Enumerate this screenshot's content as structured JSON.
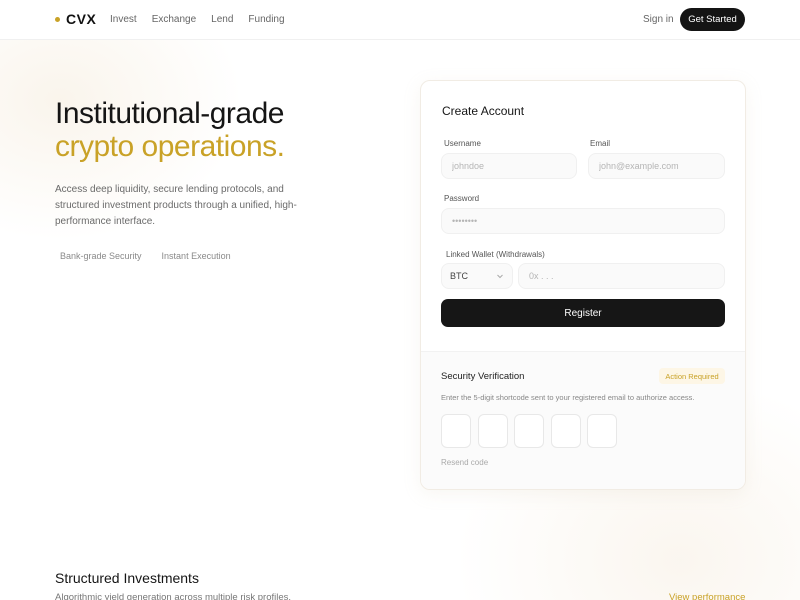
{
  "brand": {
    "name": "CVX",
    "accent": "#c9a227"
  },
  "nav": {
    "links": [
      "Invest",
      "Exchange",
      "Lend",
      "Funding"
    ],
    "sign_in": "Sign in",
    "cta": "Get Started"
  },
  "hero": {
    "title_line1": "Institutional-grade",
    "title_line2": "crypto operations.",
    "description": "Access deep liquidity, secure lending protocols, and structured investment products through a unified, high-performance interface.",
    "tags": [
      "Bank-grade Security",
      "Instant Execution"
    ]
  },
  "form": {
    "title": "Create Account",
    "username_label": "Username",
    "username_placeholder": "johndoe",
    "email_label": "Email",
    "email_placeholder": "john@example.com",
    "password_label": "Password",
    "password_placeholder": "••••••••",
    "wallet_label": "Linked Wallet (Withdrawals)",
    "wallet_currency": "BTC",
    "wallet_placeholder": "0x . . .",
    "register_label": "Register"
  },
  "verification": {
    "title": "Security Verification",
    "badge": "Action Required",
    "description": "Enter the 5-digit shortcode sent to your registered email to authorize access.",
    "resend": "Resend code"
  },
  "section": {
    "title": "Structured Investments",
    "description": "Algorithmic yield generation across multiple risk profiles.",
    "link": "View performance"
  }
}
